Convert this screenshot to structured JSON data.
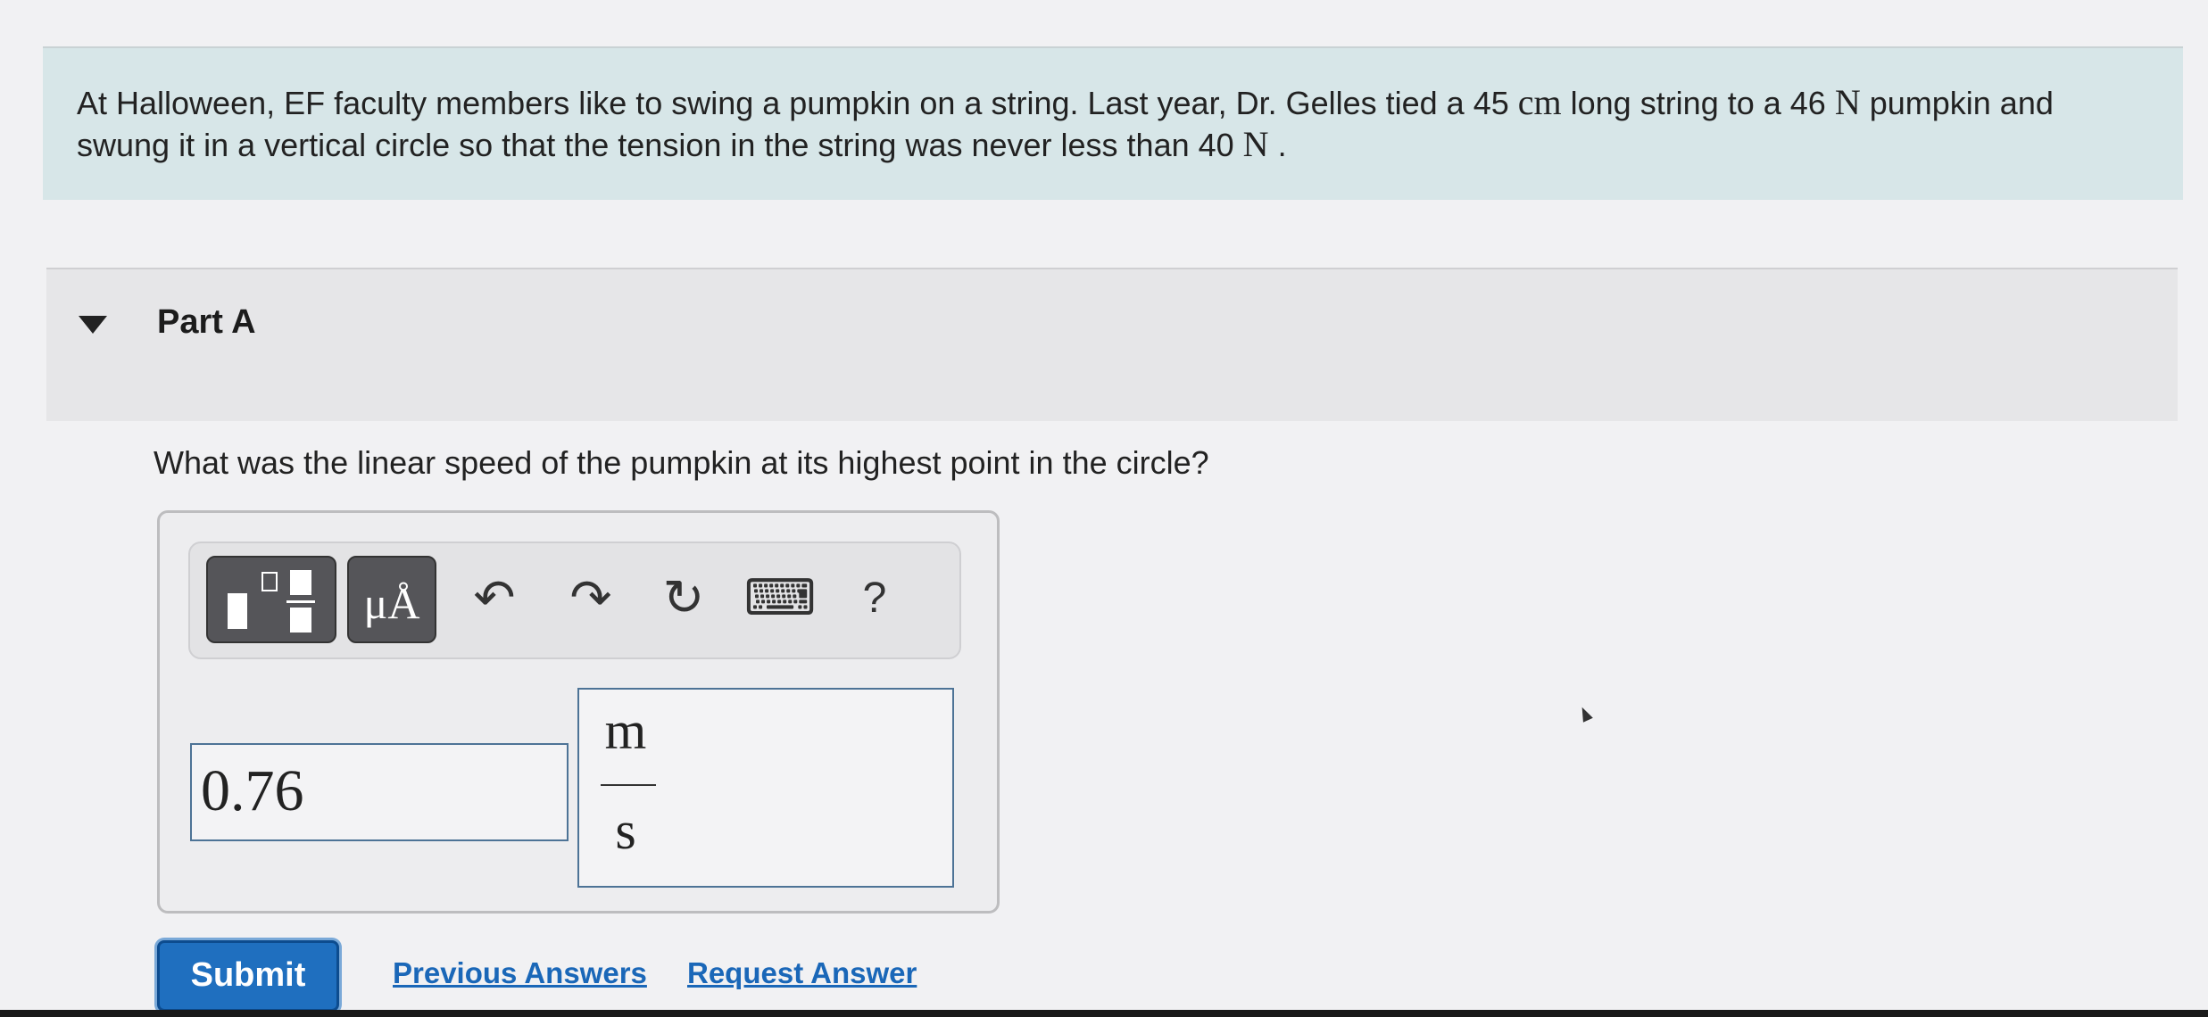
{
  "intro": {
    "text_1": "At Halloween, EF faculty members like to swing a pumpkin on a string. Last year, Dr. Gelles tied a 45 ",
    "unit_1": "cm",
    "text_2": " long string to a 46 ",
    "unit_2": "N",
    "text_3": " pumpkin and swung it in a vertical circle so that the tension in the string was never less than 40 ",
    "unit_3": "N",
    "text_4": " ."
  },
  "part": {
    "title": "Part A",
    "question": "What was the linear speed of the pumpkin at its highest point in the circle?"
  },
  "toolbar": {
    "template_icon": "fraction-template-icon",
    "units_label": "μÅ",
    "undo_glyph": "↶",
    "redo_glyph": "↷",
    "reset_glyph": "↻",
    "keyboard_glyph": "⌨",
    "help_label": "?"
  },
  "answer": {
    "value": "0.76",
    "unit_numerator": "m",
    "unit_denominator": "s"
  },
  "actions": {
    "submit_label": "Submit",
    "previous_answers_label": "Previous Answers",
    "request_answer_label": "Request Answer"
  },
  "colors": {
    "intro_bg": "#d7e6e8",
    "part_header_bg": "#e6e6e8",
    "submit_bg": "#1f6fbf",
    "link": "#1a67b8",
    "input_border": "#4d7396"
  }
}
